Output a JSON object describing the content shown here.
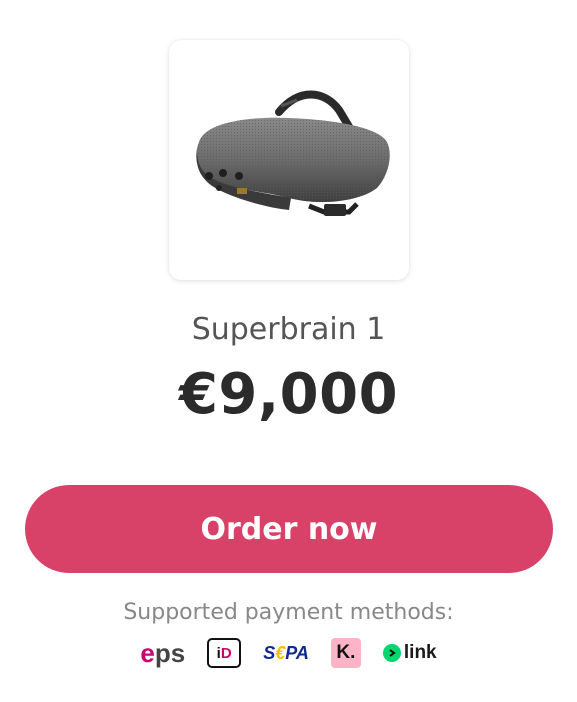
{
  "product": {
    "image_icon": "vr-headset-image",
    "title": "Superbrain 1",
    "price": "€9,000"
  },
  "order": {
    "button_label": "Order now",
    "accent_color": "#d94268"
  },
  "payments": {
    "caption": "Supported payment methods:",
    "methods": {
      "eps": {
        "e": "e",
        "rest": "ps"
      },
      "ideal": {
        "i": "i",
        "d": "D"
      },
      "sepa": {
        "s": "S",
        "eu": "€",
        "pa": "PA"
      },
      "klarna": "K.",
      "link": "link"
    }
  }
}
